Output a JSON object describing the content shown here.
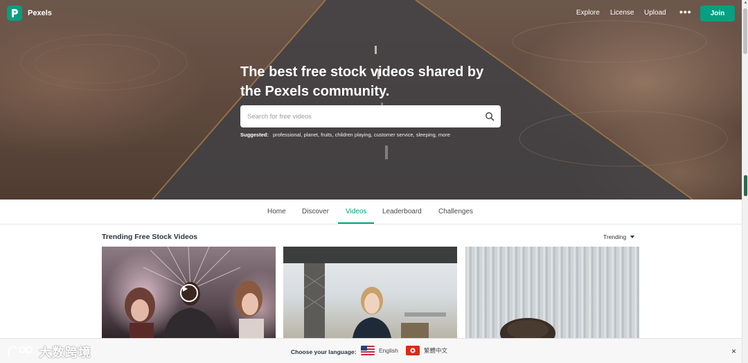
{
  "brand": {
    "name": "Pexels",
    "accent_color": "#05a081"
  },
  "header": {
    "nav": [
      {
        "label": "Explore"
      },
      {
        "label": "License"
      },
      {
        "label": "Upload"
      }
    ],
    "more_label": "•••",
    "join_label": "Join"
  },
  "hero": {
    "title": "The best free stock videos shared by the Pexels community.",
    "search": {
      "placeholder": "Search for free videos",
      "value": "",
      "icon": "search-icon"
    },
    "suggested": {
      "label": "Suggested:",
      "items": "professional, planet, fruits, children playing, customer service, sleeping, more"
    }
  },
  "tabs": [
    {
      "label": "Home",
      "active": false
    },
    {
      "label": "Discover",
      "active": false
    },
    {
      "label": "Videos",
      "active": true
    },
    {
      "label": "Leaderboard",
      "active": false
    },
    {
      "label": "Challenges",
      "active": false
    }
  ],
  "main": {
    "section_title": "Trending Free Stock Videos",
    "sort": {
      "selected": "Trending"
    },
    "videos": [
      {
        "label": "video-1",
        "play_icon": "play-icon"
      },
      {
        "label": "video-2"
      },
      {
        "label": "video-3"
      }
    ]
  },
  "language_bar": {
    "watermark": "大数跨境",
    "label": "Choose your language:",
    "options": [
      {
        "label": "English",
        "flag": "us-flag-icon"
      },
      {
        "label": "繁體中文",
        "flag": "hk-flag-icon"
      }
    ],
    "close": "×"
  }
}
